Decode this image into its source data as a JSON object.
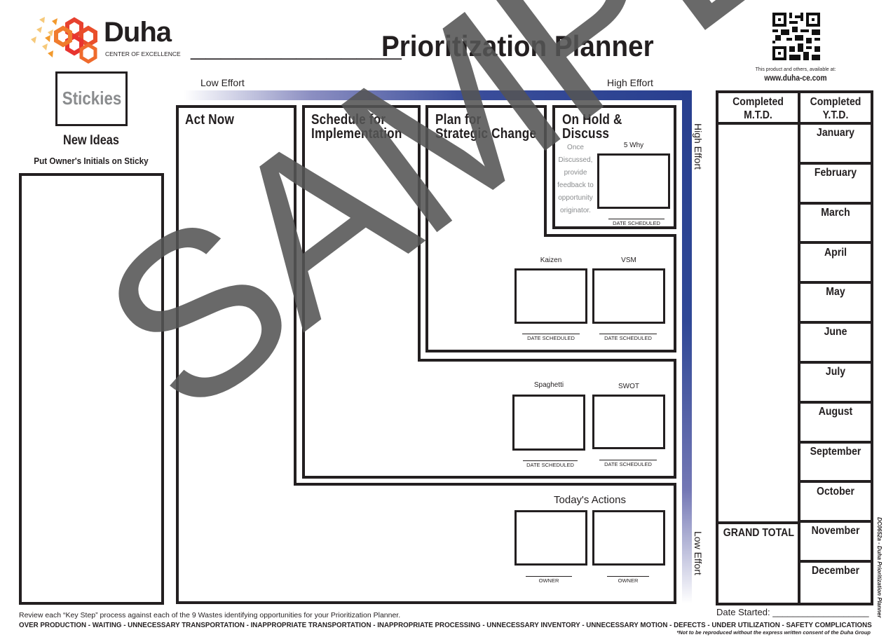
{
  "header": {
    "brand_name": "Duha",
    "brand_sub": "CENTER OF EXCELLENCE",
    "title_blank": "______________",
    "title": "Prioritization Planner",
    "availability_text": "This product and others, available at:",
    "website": "www.duha-ce.com"
  },
  "stickies": {
    "label": "Stickies",
    "new_ideas": "New Ideas",
    "instruction": "Put Owner's Initials on Sticky"
  },
  "effort_axis": {
    "top_left": "Low Effort",
    "top_right": "High Effort",
    "right_top": "High Effort",
    "right_bottom": "Low Effort",
    "gradient_color": "#283f8f"
  },
  "quadrants": {
    "act_now": "Act Now",
    "schedule": "Schedule for Implementation",
    "schedule_line1": "Schedule for",
    "schedule_line2": "Implementation",
    "plan_line1": "Plan for",
    "plan_line2": "Strategic Change",
    "on_hold_line1": "On Hold &",
    "on_hold_line2": "Discuss",
    "on_hold_note": [
      "Once",
      "Discussed,",
      "provide",
      "feedback to",
      "opportunity",
      "originator."
    ],
    "five_why": "5 Why",
    "date_scheduled": "DATE SCHEDULED",
    "kaizen": "Kaizen",
    "vsm": "VSM",
    "spaghetti": "Spaghetti",
    "swot": "SWOT",
    "todays_actions": "Today's Actions",
    "owner": "OWNER"
  },
  "tracker": {
    "mtd_line1": "Completed",
    "mtd_line2": "M.T.D.",
    "ytd_line1": "Completed",
    "ytd_line2": "Y.T.D.",
    "grand_total": "GRAND TOTAL",
    "months": [
      "January",
      "February",
      "March",
      "April",
      "May",
      "June",
      "July",
      "August",
      "September",
      "October",
      "November",
      "December"
    ],
    "date_started": "Date Started: ___________________"
  },
  "footer": {
    "instruction": "Review each “Key Step” process against each of the 9 Wastes identifying opportunities for your Prioritization Planner.",
    "wastes": "OVER PRODUCTION - WAITING - UNNECESSARY TRANSPORTATION - INAPPROPRIATE TRANSPORTATION - INAPPROPRIATE PROCESSING - UNNECESSARY INVENTORY - UNNECESSARY MOTION - DEFECTS - UNDER UTILIZATION - SAFETY COMPLICATIONS",
    "copyright": "*Not to be reproduced without the express written consent of the Duha Group",
    "side_code": "DC0652a - Duha Prioritization Planner"
  },
  "watermark": "SAMPLE"
}
